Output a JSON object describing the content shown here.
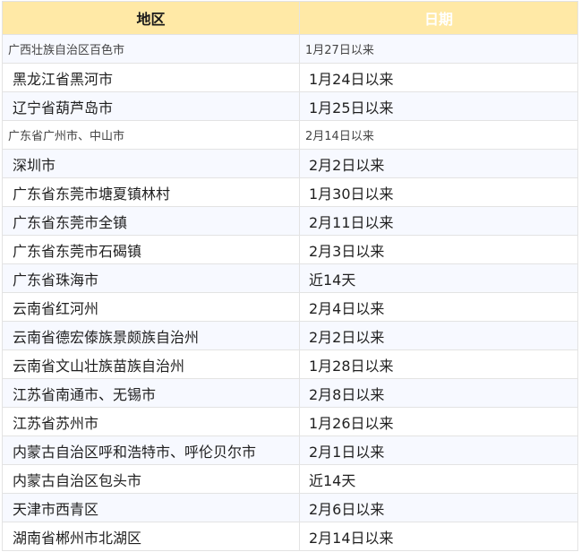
{
  "header": {
    "region": "地区",
    "date": "日期"
  },
  "rows": [
    {
      "region": "广西壮族自治区百色市",
      "date": "1月27日以来",
      "small": true
    },
    {
      "region": "黑龙江省黑河市",
      "date": "1月24日以来",
      "small": false
    },
    {
      "region": "辽宁省葫芦岛市",
      "date": "1月25日以来",
      "small": false
    },
    {
      "region": "广东省广州市、中山市",
      "date": "2月14日以来",
      "small": true
    },
    {
      "region": "深圳市",
      "date": "2月2日以来",
      "small": false
    },
    {
      "region": "广东省东莞市塘夏镇林村",
      "date": "1月30日以来",
      "small": false
    },
    {
      "region": "广东省东莞市全镇",
      "date": "2月11日以来",
      "small": false
    },
    {
      "region": "广东省东莞市石碣镇",
      "date": "2月3日以来",
      "small": false
    },
    {
      "region": "广东省珠海市",
      "date": "近14天",
      "small": false
    },
    {
      "region": "云南省红河州",
      "date": "2月4日以来",
      "small": false
    },
    {
      "region": "云南省德宏傣族景颇族自治州",
      "date": "2月2日以来",
      "small": false
    },
    {
      "region": "云南省文山壮族苗族自治州",
      "date": "1月28日以来",
      "small": false
    },
    {
      "region": "江苏省南通市、无锡市",
      "date": "2月8日以来",
      "small": false
    },
    {
      "region": "江苏省苏州市",
      "date": "1月26日以来",
      "small": false
    },
    {
      "region": "内蒙古自治区呼和浩特市、呼伦贝尔市",
      "date": "2月1日以来",
      "small": false
    },
    {
      "region": "内蒙古自治区包头市",
      "date": "近14天",
      "small": false
    },
    {
      "region": "天津市西青区",
      "date": "2月6日以来",
      "small": false
    },
    {
      "region": "湖南省郴州市北湖区",
      "date": "2月14日以来",
      "small": false
    }
  ]
}
